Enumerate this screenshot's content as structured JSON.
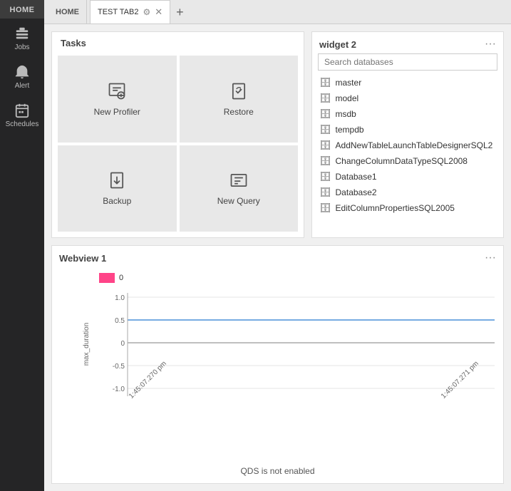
{
  "sidebar": {
    "home_label": "HOME",
    "items": [
      {
        "id": "jobs",
        "label": "Jobs",
        "icon": "jobs"
      },
      {
        "id": "alert",
        "label": "Alert",
        "icon": "alert"
      },
      {
        "id": "schedules",
        "label": "Schedules",
        "icon": "schedules"
      }
    ]
  },
  "tabbar": {
    "home": "HOME",
    "active_tab": "TEST TAB2",
    "add_label": "+"
  },
  "tasks": {
    "title": "Tasks",
    "buttons": [
      {
        "id": "new-profiler",
        "label": "New Profiler"
      },
      {
        "id": "restore",
        "label": "Restore"
      },
      {
        "id": "backup",
        "label": "Backup"
      },
      {
        "id": "new-query",
        "label": "New Query"
      }
    ]
  },
  "widget2": {
    "title": "widget 2",
    "search_placeholder": "Search databases",
    "more_label": "···",
    "databases": [
      "master",
      "model",
      "msdb",
      "tempdb",
      "AddNewTableLaunchTableDesignerSQL2",
      "ChangeColumnDataTypeSQL2008",
      "Database1",
      "Database2",
      "EditColumnPropertiesSQL2005"
    ]
  },
  "webview": {
    "title": "Webview 1",
    "more_label": "···",
    "legend_label": "0",
    "y_axis_label": "max_duration",
    "x_left": "1:45:07.270 pm",
    "x_right": "1:45:07.271 pm",
    "footer": "QDS is not enabled",
    "chart": {
      "y_ticks": [
        "1.0",
        "0.5",
        "0",
        "-0.5",
        "-1.0"
      ],
      "zero_line_pct": 50
    }
  }
}
